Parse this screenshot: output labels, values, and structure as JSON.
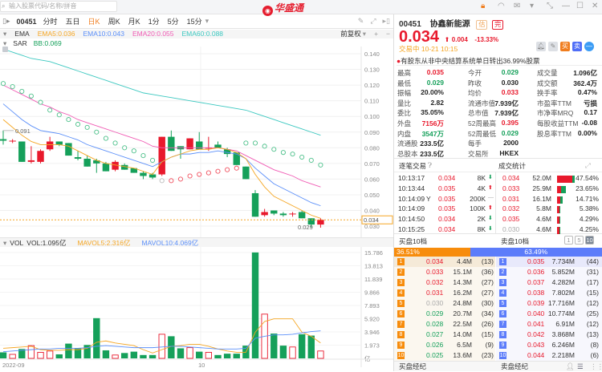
{
  "app": {
    "search_placeholder": "输入股票代码/名称/拼音",
    "logo": "华盛通"
  },
  "toolbar": {
    "code": "00451",
    "tabs": [
      "分时",
      "五日",
      "日K",
      "周K",
      "月K",
      "1分",
      "5分",
      "15分"
    ],
    "active_tab": 2
  },
  "indicators": {
    "ema_label": "EMA",
    "ema5": "EMA5:0.036",
    "ema10": "EMA10:0.043",
    "ema20": "EMA20:0.055",
    "ema60": "EMA60:0.088",
    "adjust": "前复权",
    "sar_label": "SAR",
    "bb": "BB:0.069",
    "vol_label": "VOL",
    "vol": "VOL:1.095亿",
    "mavol5": "MAVOL5:2.316亿",
    "mavol10": "MAVOL10:4.069亿"
  },
  "colors": {
    "up": "#e8192c",
    "down": "#15a05a",
    "ema5": "#f5a623",
    "ema10": "#5b8ff9",
    "ema20": "#f05bb4",
    "ema60": "#3cc8c0",
    "accent": "#f07d1e",
    "sell": "#4f6ef7"
  },
  "chart_data": {
    "type": "candlestick",
    "price_ticks": [
      "0.140",
      "0.130",
      "0.120",
      "0.110",
      "0.100",
      "0.090",
      "0.080",
      "0.070",
      "0.060",
      "0.050",
      "0.040",
      "0.030"
    ],
    "price_range": [
      0.03,
      0.14
    ],
    "last_price_label": "0.034",
    "high_label": "0.091",
    "low_label": "0.029",
    "x_labels": [
      "2022-09",
      "10"
    ],
    "ohlc": [
      [
        0.0855,
        0.091,
        0.082,
        0.0845
      ],
      [
        0.0845,
        0.0855,
        0.083,
        0.0845
      ],
      [
        0.084,
        0.084,
        0.071,
        0.071
      ],
      [
        0.071,
        0.081,
        0.07,
        0.072
      ],
      [
        0.071,
        0.079,
        0.07,
        0.078
      ],
      [
        0.079,
        0.087,
        0.078,
        0.084
      ],
      [
        0.084,
        0.084,
        0.081,
        0.082
      ],
      [
        0.083,
        0.083,
        0.075,
        0.075
      ],
      [
        0.074,
        0.078,
        0.072,
        0.073
      ],
      [
        0.073,
        0.075,
        0.068,
        0.068
      ],
      [
        0.072,
        0.073,
        0.064,
        0.07
      ],
      [
        0.07,
        0.071,
        0.065,
        0.065
      ],
      [
        0.066,
        0.072,
        0.065,
        0.071
      ],
      [
        0.069,
        0.07,
        0.066,
        0.066
      ],
      [
        0.067,
        0.067,
        0.064,
        0.064
      ],
      [
        0.064,
        0.065,
        0.06,
        0.062
      ],
      [
        0.063,
        0.064,
        0.06,
        0.061
      ],
      [
        0.063,
        0.087,
        0.062,
        0.087
      ],
      [
        0.087,
        0.091,
        0.078,
        0.078
      ],
      [
        0.081,
        0.081,
        0.073,
        0.079
      ],
      [
        0.079,
        0.086,
        0.079,
        0.086
      ],
      [
        0.084,
        0.09,
        0.079,
        0.079
      ],
      [
        0.08,
        0.087,
        0.078,
        0.08
      ],
      [
        0.082,
        0.084,
        0.08,
        0.08
      ],
      [
        0.079,
        0.08,
        0.074,
        0.076
      ],
      [
        0.077,
        0.077,
        0.069,
        0.069
      ],
      [
        0.068,
        0.068,
        0.06,
        0.06
      ],
      [
        0.051,
        0.053,
        0.036,
        0.036
      ],
      [
        0.037,
        0.041,
        0.036,
        0.039
      ],
      [
        0.04,
        0.04,
        0.037,
        0.038
      ],
      [
        0.038,
        0.039,
        0.036,
        0.037
      ],
      [
        0.038,
        0.039,
        0.036,
        0.038
      ],
      [
        0.039,
        0.04,
        0.035,
        0.035
      ],
      [
        0.035,
        0.035,
        0.029,
        0.031
      ],
      [
        0.031,
        0.035,
        0.029,
        0.034
      ]
    ],
    "ema60": [
      0.143,
      0.141,
      0.139,
      0.137,
      0.136,
      0.135,
      0.133,
      0.131,
      0.129,
      0.127,
      0.125,
      0.123,
      0.121,
      0.119,
      0.117,
      0.115,
      0.114,
      0.113,
      0.112,
      0.111,
      0.11,
      0.109,
      0.108,
      0.107,
      0.106,
      0.105,
      0.104,
      0.102,
      0.1,
      0.098,
      0.096,
      0.094,
      0.092,
      0.09,
      0.088
    ],
    "ema20": [
      0.12,
      0.117,
      0.114,
      0.111,
      0.108,
      0.106,
      0.103,
      0.101,
      0.098,
      0.096,
      0.094,
      0.092,
      0.09,
      0.088,
      0.086,
      0.084,
      0.081,
      0.08,
      0.08,
      0.08,
      0.08,
      0.08,
      0.08,
      0.08,
      0.079,
      0.078,
      0.075,
      0.072,
      0.069,
      0.066,
      0.064,
      0.062,
      0.059,
      0.057,
      0.055
    ],
    "ema10": [
      0.108,
      0.103,
      0.098,
      0.094,
      0.091,
      0.09,
      0.089,
      0.087,
      0.085,
      0.082,
      0.08,
      0.078,
      0.076,
      0.074,
      0.072,
      0.07,
      0.068,
      0.071,
      0.074,
      0.076,
      0.076,
      0.077,
      0.077,
      0.078,
      0.077,
      0.076,
      0.073,
      0.067,
      0.062,
      0.057,
      0.054,
      0.051,
      0.048,
      0.045,
      0.043
    ],
    "ema5": [
      0.098,
      0.093,
      0.088,
      0.084,
      0.082,
      0.082,
      0.082,
      0.081,
      0.078,
      0.075,
      0.072,
      0.07,
      0.069,
      0.068,
      0.067,
      0.065,
      0.063,
      0.071,
      0.074,
      0.076,
      0.078,
      0.079,
      0.079,
      0.08,
      0.079,
      0.077,
      0.073,
      0.063,
      0.055,
      0.049,
      0.046,
      0.043,
      0.04,
      0.037,
      0.035
    ],
    "sar": [
      0.121,
      0.119,
      0.116,
      0.113,
      0.109,
      0.104,
      0.101,
      0.098,
      0.095,
      0.093,
      0.09,
      0.086,
      0.083,
      0.08,
      0.078,
      0.075,
      0.072,
      0.059,
      0.059,
      0.06,
      0.062,
      0.063,
      0.064,
      0.065,
      0.066,
      0.067,
      0.083,
      0.083,
      0.081,
      0.079,
      0.077,
      0.076,
      0.074,
      0.072,
      0.069
    ],
    "vol_ticks": [
      "15.786",
      "13.813",
      "11.839",
      "9.866",
      "7.893",
      "5.920",
      "3.946",
      "1.973",
      "亿"
    ],
    "vol_max": 15.786,
    "volume": [
      0.9,
      0.6,
      1.4,
      1.9,
      0.9,
      1.1,
      0.6,
      2.2,
      1.5,
      2.0,
      6.0,
      1.2,
      0.5,
      0.8,
      1.0,
      0.5,
      0.5,
      3.6,
      3.3,
      1.5,
      1.6,
      1.0,
      0.9,
      0.5,
      0.7,
      0.7,
      1.9,
      15.8,
      6.6,
      3.7,
      1.9,
      1.7,
      3.6,
      3.4,
      1.1
    ],
    "mavol5": [
      1.5,
      1.6,
      1.7,
      1.8,
      1.3,
      1.2,
      1.2,
      1.3,
      1.3,
      1.5,
      2.4,
      2.6,
      2.3,
      2.1,
      1.9,
      1.3,
      0.8,
      1.3,
      1.8,
      1.9,
      2.1,
      2.1,
      1.8,
      1.4,
      1.1,
      0.9,
      0.9,
      3.9,
      5.5,
      5.9,
      5.9,
      5.9,
      3.9,
      3.3,
      2.3
    ],
    "mavol10": [
      1.0,
      1.1,
      1.2,
      1.3,
      1.4,
      1.4,
      1.5,
      1.5,
      1.5,
      1.6,
      1.8,
      1.9,
      1.8,
      1.7,
      1.6,
      1.6,
      1.6,
      1.7,
      1.8,
      1.8,
      1.7,
      1.6,
      1.5,
      1.4,
      1.4,
      1.4,
      1.5,
      3.0,
      3.3,
      3.5,
      3.5,
      3.6,
      3.8,
      4.0,
      4.1
    ]
  },
  "quote": {
    "code": "00451",
    "name": "协鑫新能源",
    "tag1": "估",
    "tag2": "完",
    "price": "0.034",
    "change": "0.004",
    "change_pct": "-13.33%",
    "status": "交易中 10-21 10:15",
    "notice": "有股东从非中央结算系统单日转出36.99%股票",
    "stats": [
      [
        "最高",
        "0.035",
        "red",
        "今开",
        "0.029",
        "green",
        "成交量",
        "1.096亿",
        ""
      ],
      [
        "最低",
        "0.029",
        "green",
        "昨收",
        "0.030",
        "",
        "成交额",
        "362.4万",
        ""
      ],
      [
        "振幅",
        "20.00%",
        "",
        "均价",
        "0.033",
        "red",
        "换手率",
        "0.47%",
        ""
      ],
      [
        "量比",
        "2.82",
        "",
        "流通市值",
        "7.939亿",
        "",
        "市盈率TTM",
        "亏损",
        ""
      ],
      [
        "委比",
        "35.05%",
        "",
        "总市值",
        "7.939亿",
        "",
        "市净率MRQ",
        "0.17",
        ""
      ],
      [
        "外盘",
        "7156万",
        "red",
        "52周最高",
        "0.395",
        "red",
        "每股收益TTM",
        "-0.08",
        ""
      ],
      [
        "内盘",
        "3547万",
        "green",
        "52周最低",
        "0.029",
        "green",
        "股息率TTM",
        "0.00%",
        ""
      ],
      [
        "流通股",
        "233.5亿",
        "",
        "每手",
        "2000",
        "",
        "",
        "",
        ""
      ],
      [
        "总股本",
        "233.5亿",
        "",
        "交易所",
        "HKEX",
        "",
        "",
        "",
        ""
      ]
    ]
  },
  "trades": {
    "title": "逐笔交易",
    "stats_title": "成交统计",
    "rows": [
      [
        "10:13:17",
        "",
        "0.034",
        "8K",
        "down"
      ],
      [
        "10:13:44",
        "",
        "0.035",
        "4K",
        "up"
      ],
      [
        "10:14:09",
        "Y",
        "0.035",
        "200K",
        "flat"
      ],
      [
        "10:14:09",
        "",
        "0.035",
        "100K",
        "up"
      ],
      [
        "10:14:50",
        "",
        "0.034",
        "2K",
        "down"
      ],
      [
        "10:15:25",
        "",
        "0.034",
        "8K",
        "down"
      ]
    ],
    "stats": [
      [
        "0.034",
        "52.0M",
        "47.54%",
        47.54,
        0.85
      ],
      [
        "0.033",
        "25.9M",
        "23.65%",
        23.65,
        0.45
      ],
      [
        "0.031",
        "16.1M",
        "14.71%",
        14.71,
        0.6
      ],
      [
        "0.032",
        "5.8M",
        "5.38%",
        5.38,
        0.8
      ],
      [
        "0.035",
        "4.6M",
        "4.29%",
        4.29,
        0.8
      ],
      [
        "0.030",
        "4.6M",
        "4.25%",
        4.25,
        0.8
      ]
    ]
  },
  "orderbook": {
    "bid_title": "买盘10档",
    "ask_title": "卖盘10档",
    "depth_options": [
      "1",
      "5",
      "10"
    ],
    "bid_pct": "36.51%",
    "ask_pct": "63.49%",
    "bid_ratio": 36.51,
    "bids": [
      [
        "1",
        "0.034",
        "4.4M",
        "(13)",
        "red"
      ],
      [
        "2",
        "0.033",
        "15.1M",
        "(36)",
        "red"
      ],
      [
        "3",
        "0.032",
        "14.3M",
        "(27)",
        "red"
      ],
      [
        "4",
        "0.031",
        "16.2M",
        "(27)",
        "red"
      ],
      [
        "5",
        "0.030",
        "24.8M",
        "(30)",
        "gray"
      ],
      [
        "6",
        "0.029",
        "20.7M",
        "(34)",
        "green"
      ],
      [
        "7",
        "0.028",
        "22.5M",
        "(26)",
        "green"
      ],
      [
        "8",
        "0.027",
        "14.0M",
        "(15)",
        "green"
      ],
      [
        "9",
        "0.026",
        "6.5M",
        "(9)",
        "green"
      ],
      [
        "10",
        "0.025",
        "13.6M",
        "(23)",
        "green"
      ]
    ],
    "asks": [
      [
        "1",
        "0.035",
        "7.734M",
        "(44)"
      ],
      [
        "2",
        "0.036",
        "5.852M",
        "(31)"
      ],
      [
        "3",
        "0.037",
        "4.282M",
        "(17)"
      ],
      [
        "4",
        "0.038",
        "7.802M",
        "(15)"
      ],
      [
        "5",
        "0.039",
        "17.716M",
        "(12)"
      ],
      [
        "6",
        "0.040",
        "10.774M",
        "(25)"
      ],
      [
        "7",
        "0.041",
        "6.91M",
        "(12)"
      ],
      [
        "8",
        "0.042",
        "3.868M",
        "(13)"
      ],
      [
        "9",
        "0.043",
        "6.246M",
        "(8)"
      ],
      [
        "10",
        "0.044",
        "2.218M",
        "(6)"
      ]
    ],
    "bid_broker": "买盘经纪",
    "ask_broker": "卖盘经纪"
  }
}
